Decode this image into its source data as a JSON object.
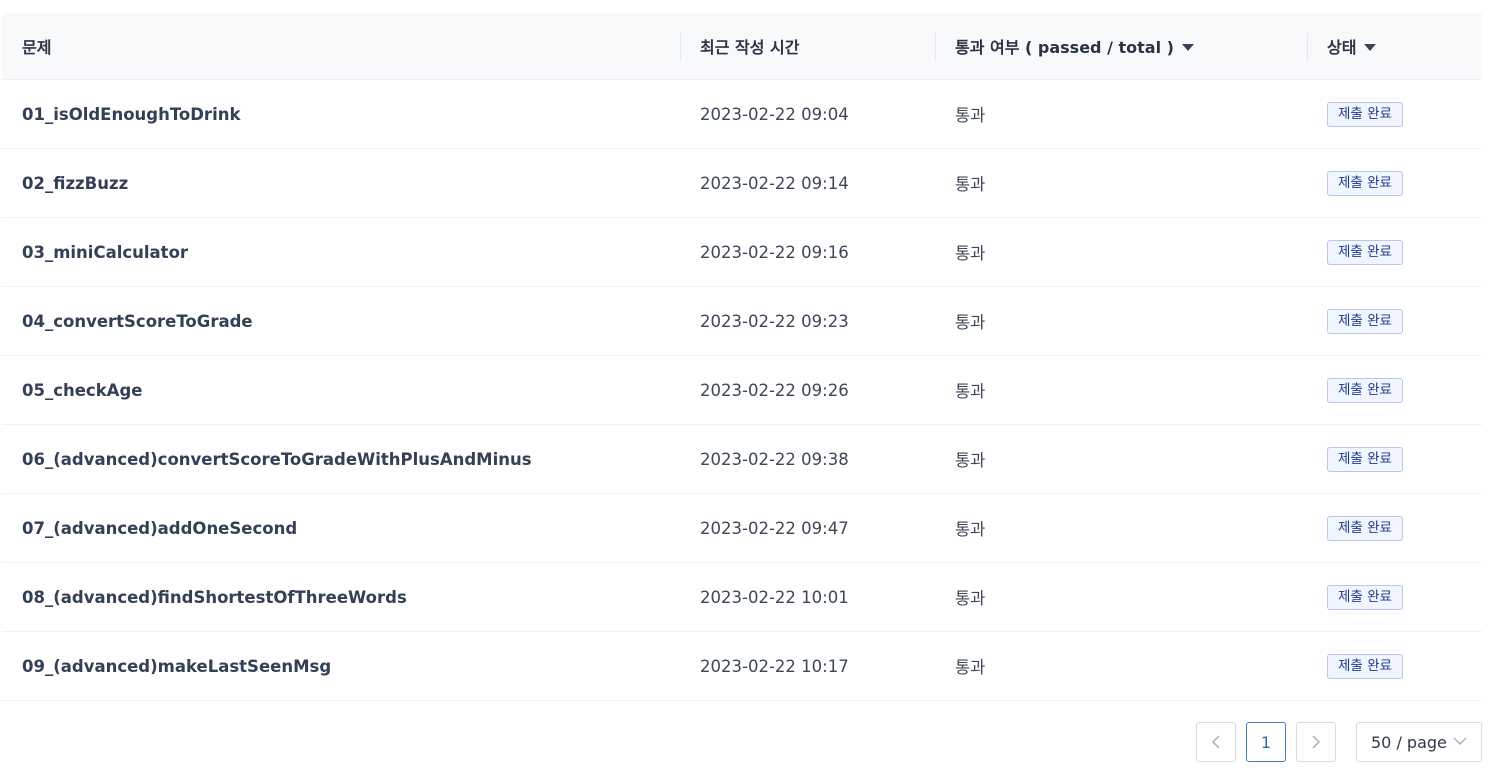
{
  "table": {
    "headers": {
      "problem": "문제",
      "time": "최근 작성 시간",
      "pass": "통과 여부 ( passed / total )",
      "status": "상태"
    },
    "rows": [
      {
        "problem": "01_isOldEnoughToDrink",
        "time": "2023-02-22 09:04",
        "pass": "통과",
        "status": "제출 완료"
      },
      {
        "problem": "02_fizzBuzz",
        "time": "2023-02-22 09:14",
        "pass": "통과",
        "status": "제출 완료"
      },
      {
        "problem": "03_miniCalculator",
        "time": "2023-02-22 09:16",
        "pass": "통과",
        "status": "제출 완료"
      },
      {
        "problem": "04_convertScoreToGrade",
        "time": "2023-02-22 09:23",
        "pass": "통과",
        "status": "제출 완료"
      },
      {
        "problem": "05_checkAge",
        "time": "2023-02-22 09:26",
        "pass": "통과",
        "status": "제출 완료"
      },
      {
        "problem": "06_(advanced)convertScoreToGradeWithPlusAndMinus",
        "time": "2023-02-22 09:38",
        "pass": "통과",
        "status": "제출 완료"
      },
      {
        "problem": "07_(advanced)addOneSecond",
        "time": "2023-02-22 09:47",
        "pass": "통과",
        "status": "제출 완료"
      },
      {
        "problem": "08_(advanced)findShortestOfThreeWords",
        "time": "2023-02-22 10:01",
        "pass": "통과",
        "status": "제출 완료"
      },
      {
        "problem": "09_(advanced)makeLastSeenMsg",
        "time": "2023-02-22 10:17",
        "pass": "통과",
        "status": "제출 완료"
      }
    ]
  },
  "pagination": {
    "current_page": "1",
    "page_size": "50 / page",
    "prev_icon": "chevron-left-icon",
    "next_icon": "chevron-right-icon",
    "dropdown_icon": "chevron-down-icon"
  },
  "colors": {
    "badge_border": "#b9c6ee",
    "badge_bg": "#f1f5ff",
    "badge_text": "#1f3a8a",
    "active_page": "#3b82c8"
  }
}
